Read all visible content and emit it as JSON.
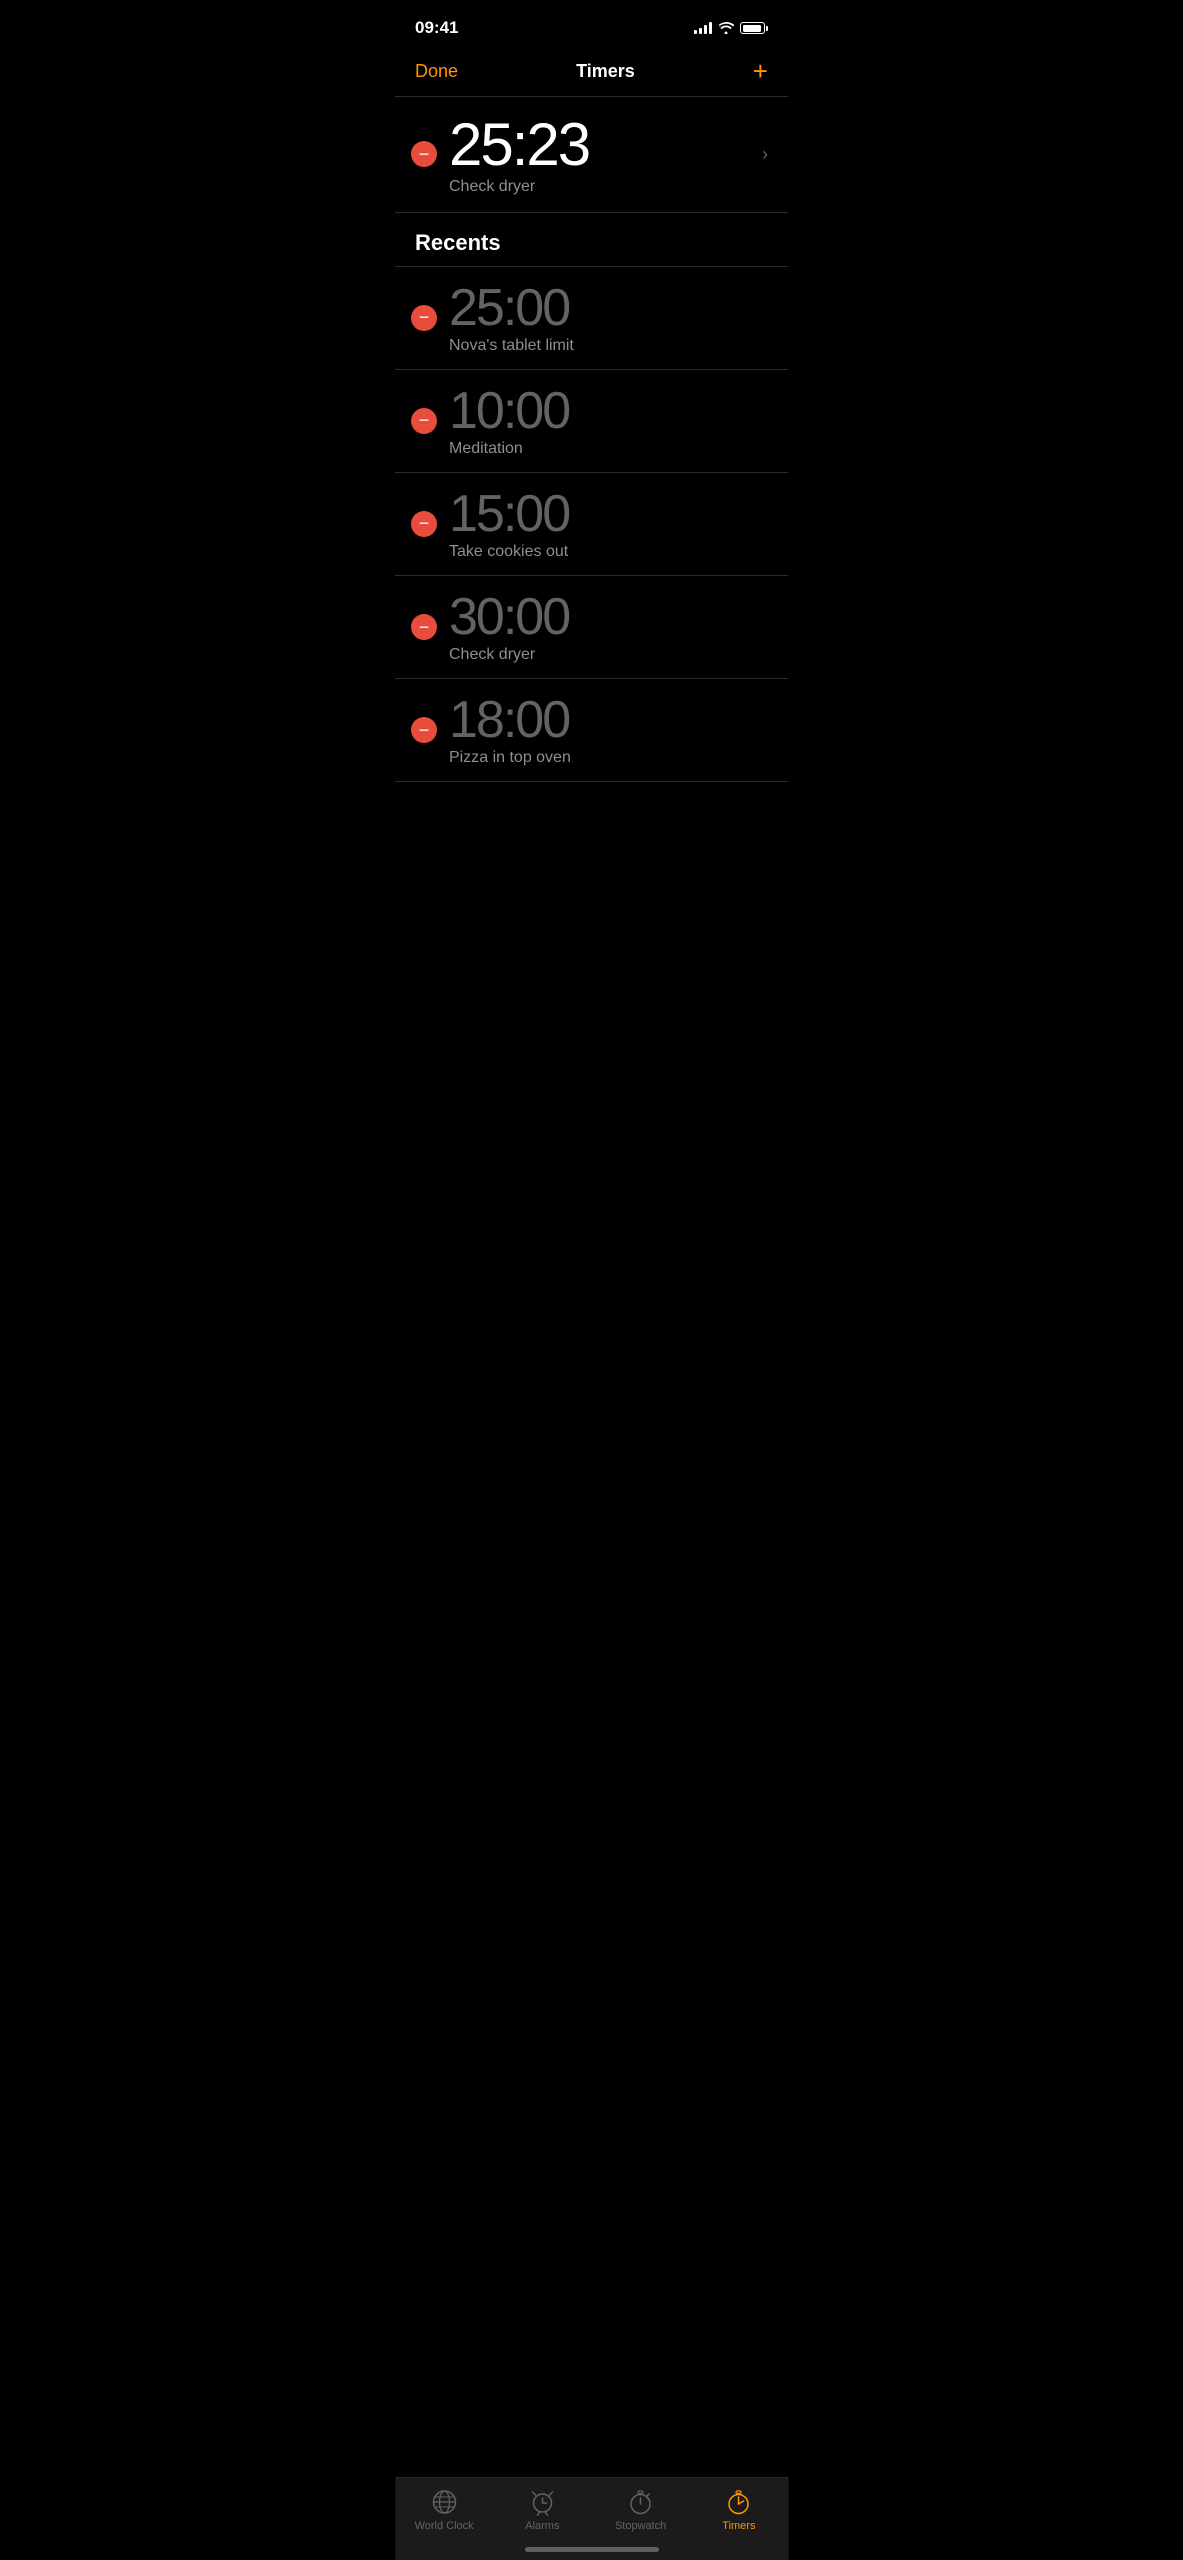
{
  "statusBar": {
    "time": "09:41"
  },
  "navBar": {
    "doneLabel": "Done",
    "title": "Timers",
    "addLabel": "+"
  },
  "activeTimer": {
    "time": "25:23",
    "label": "Check dryer"
  },
  "recents": {
    "header": "Recents",
    "items": [
      {
        "time": "25:00",
        "label": "Nova's tablet limit"
      },
      {
        "time": "10:00",
        "label": "Meditation"
      },
      {
        "time": "15:00",
        "label": "Take cookies out"
      },
      {
        "time": "30:00",
        "label": "Check dryer"
      },
      {
        "time": "18:00",
        "label": "Pizza in top oven"
      }
    ]
  },
  "tabBar": {
    "items": [
      {
        "id": "world-clock",
        "label": "World Clock",
        "active": false
      },
      {
        "id": "alarms",
        "label": "Alarms",
        "active": false
      },
      {
        "id": "stopwatch",
        "label": "Stopwatch",
        "active": false
      },
      {
        "id": "timers",
        "label": "Timers",
        "active": true
      }
    ]
  },
  "colors": {
    "accent": "#FF9500",
    "deleteRed": "#e74c3c",
    "inactiveText": "#636366",
    "dimText": "#8e8e93"
  }
}
